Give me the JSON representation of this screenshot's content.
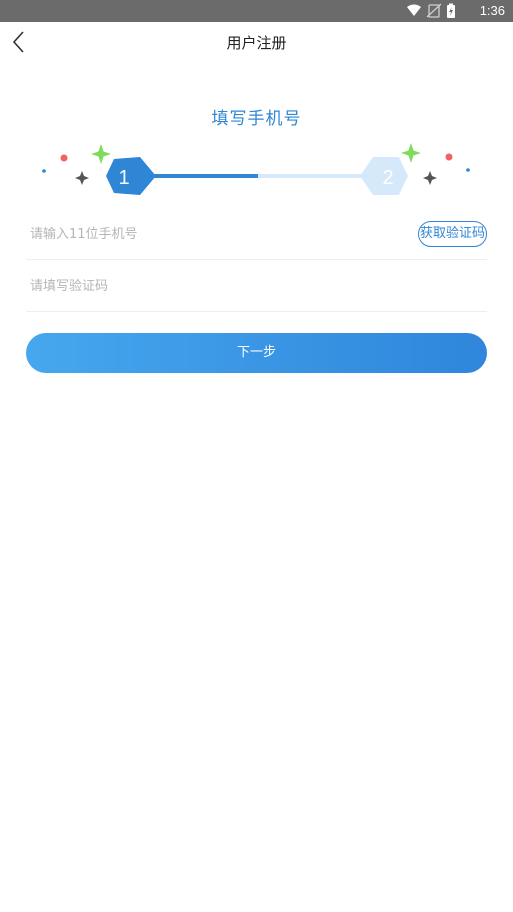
{
  "status_bar": {
    "time": "1:36",
    "icons": [
      "wifi-icon",
      "no-sim-icon",
      "battery-charging-icon"
    ]
  },
  "nav": {
    "title": "用户注册",
    "back_icon": "chevron-left-icon"
  },
  "step_title": "填写手机号",
  "stepper": {
    "steps": [
      "1",
      "2"
    ],
    "current_step": 1,
    "active_color": "#2f86d4",
    "inactive_color": "#d6e9fb",
    "sparkle_green": "#7fdc5a",
    "dot_red": "#f06262",
    "dot_blue": "#2f86d4",
    "star_gray": "#555555"
  },
  "form": {
    "phone_placeholder": "请输入11位手机号",
    "get_code_label": "获取验证码",
    "code_placeholder": "请填写验证码"
  },
  "next_button": {
    "label": "下一步"
  }
}
